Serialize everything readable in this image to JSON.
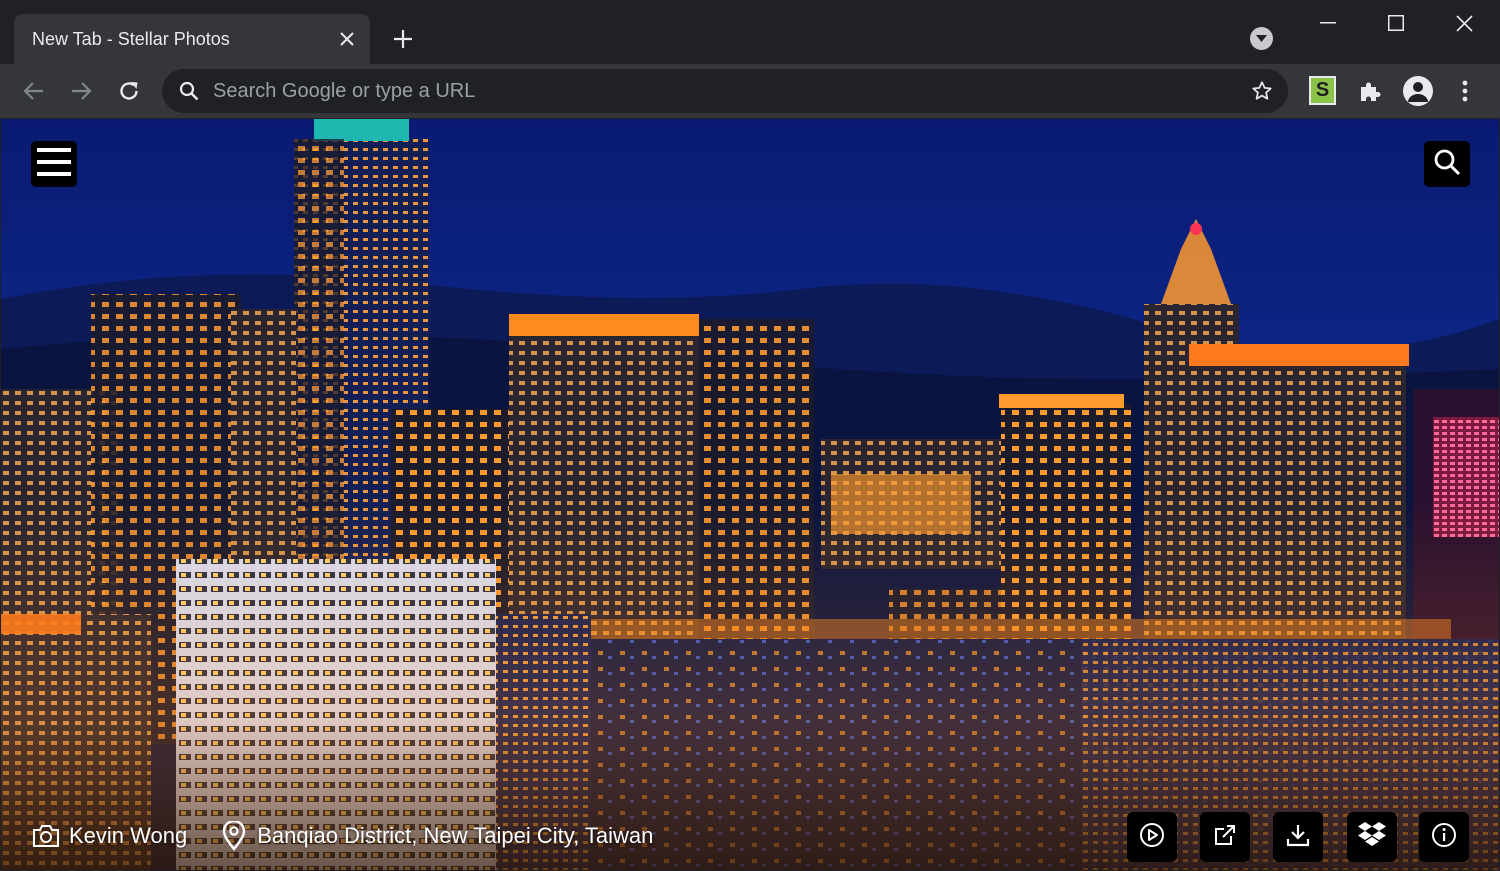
{
  "browser": {
    "tab_title": "New Tab - Stellar Photos",
    "omnibox_placeholder": "Search Google or type a URL",
    "extension_badge": "S"
  },
  "photo": {
    "photographer": "Kevin Wong",
    "location": "Banqiao District, New Taipei City, Taiwan"
  },
  "colors": {
    "chrome_dark": "#202124",
    "chrome_toolbar": "#35363a",
    "sky_top": "#0b1a6b",
    "city_light": "#ff9d3a"
  },
  "icons": {
    "menu": "hamburger-icon",
    "search": "search-icon",
    "camera": "camera-icon",
    "location": "map-pin-icon",
    "actions": [
      "play-icon",
      "external-link-icon",
      "download-icon",
      "dropbox-icon",
      "info-icon"
    ]
  }
}
